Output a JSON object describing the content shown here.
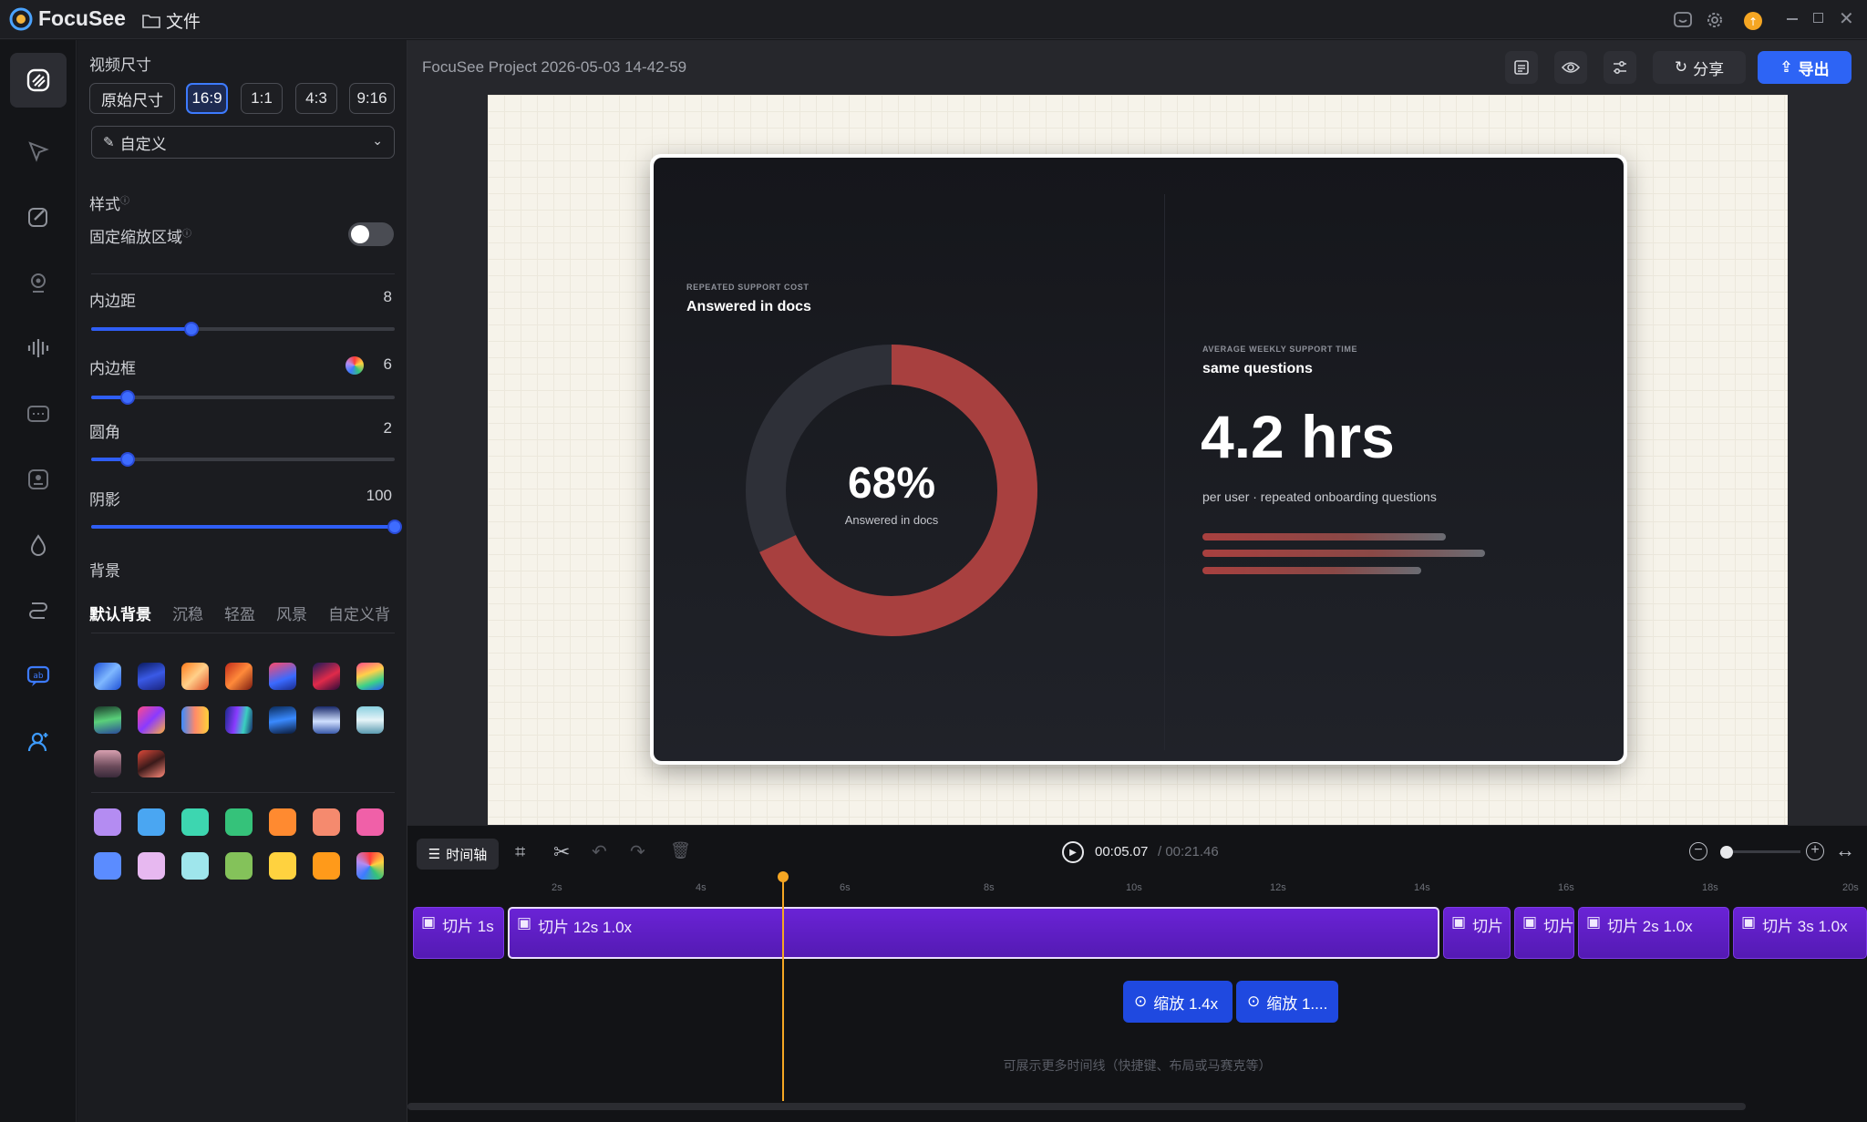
{
  "app": {
    "name": "FocuSee",
    "file_menu": "文件"
  },
  "left_panel": {
    "video_size_label": "视频尺寸",
    "ratios": [
      "原始尺寸",
      "16:9",
      "1:1",
      "4:3",
      "9:16"
    ],
    "selected_ratio": "16:9",
    "preset_select": "自定义",
    "style_label": "样式",
    "fixed_zoom_label": "固定缩放区域",
    "fixed_zoom_on": false,
    "sliders": [
      {
        "label": "内边距",
        "value": "8",
        "fraction": 0.33
      },
      {
        "label": "内边框",
        "value": "6",
        "fraction": 0.12
      },
      {
        "label": "圆角",
        "value": "2",
        "fraction": 0.12
      },
      {
        "label": "阴影",
        "value": "100",
        "fraction": 1.0
      }
    ],
    "background_label": "背景",
    "bg_tabs": [
      "默认背景",
      "沉稳",
      "轻盈",
      "风景",
      "自定义背"
    ],
    "solid_colors": [
      "#b48cf2",
      "#4aa6f2",
      "#3dd6b0",
      "#35c27a",
      "#ff8a30",
      "#f58a6e",
      "#f060a8",
      "#5b8cff",
      "#e7b8f0",
      "#9fe6ec",
      "#84c25a",
      "#ffd23f",
      "#ff9a1a",
      "#ff3b3b"
    ]
  },
  "header": {
    "project_title": "FocuSee Project 2026-05-03 14-42-59",
    "share_label": "分享",
    "export_label": "导出"
  },
  "preview": {
    "left_caption": "REPEATED SUPPORT COST",
    "left_title": "Answered in docs",
    "donut_value": "68%",
    "donut_sub": "Answered in docs",
    "donut_percent": 68,
    "right_caption": "AVERAGE WEEKLY SUPPORT TIME",
    "right_title": "same questions",
    "big_stat": "4.2 hrs",
    "stat_sub": "per user · repeated onboarding questions",
    "accent": "#a8403f"
  },
  "timeline": {
    "tab_label": "时间轴",
    "current_time": "00:05.07",
    "total_time": "/ 00:21.46",
    "ruler": [
      "2s",
      "4s",
      "6s",
      "8s",
      "10s",
      "12s",
      "14s",
      "16s",
      "18s",
      "20s"
    ],
    "clips": [
      {
        "text": "切片   1s"
      },
      {
        "text": "切片   12s   1.0x"
      },
      {
        "text": "切片"
      },
      {
        "text": "切片"
      },
      {
        "text": "切片   2s   1.0x"
      },
      {
        "text": "切片   3s   1.0x"
      }
    ],
    "zooms": [
      {
        "text": "缩放   1.4x"
      },
      {
        "text": "缩放   1...."
      }
    ],
    "hint": "可展示更多时间线（快捷键、布局或马赛克等）"
  }
}
